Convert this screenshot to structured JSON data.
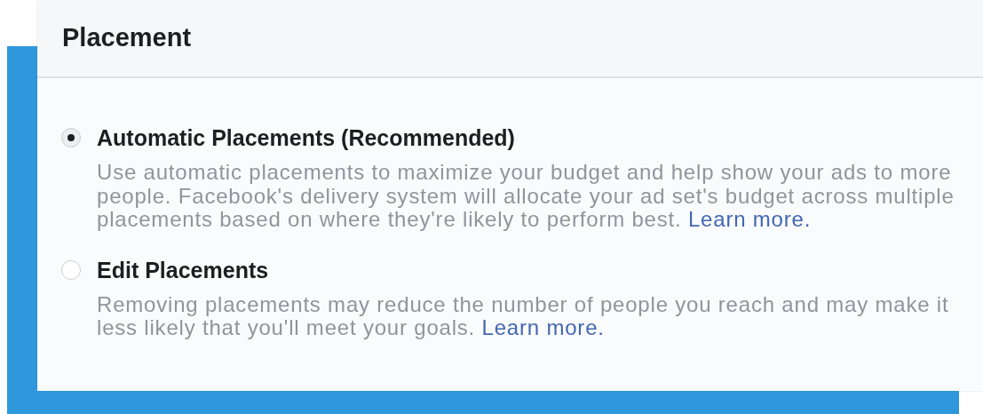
{
  "panel": {
    "title": "Placement"
  },
  "options": [
    {
      "label": "Automatic Placements (Recommended)",
      "selected": true,
      "description": "Use automatic placements to maximize your budget and help show your ads to more people. Facebook's delivery system will allocate your ad set's budget across multiple placements based on where they're likely to perform best.",
      "link": "Learn more."
    },
    {
      "label": "Edit Placements",
      "selected": false,
      "description": "Removing placements may reduce the number of people you reach and may make it less likely that you'll meet your goals.",
      "link": "Learn more."
    }
  ]
}
